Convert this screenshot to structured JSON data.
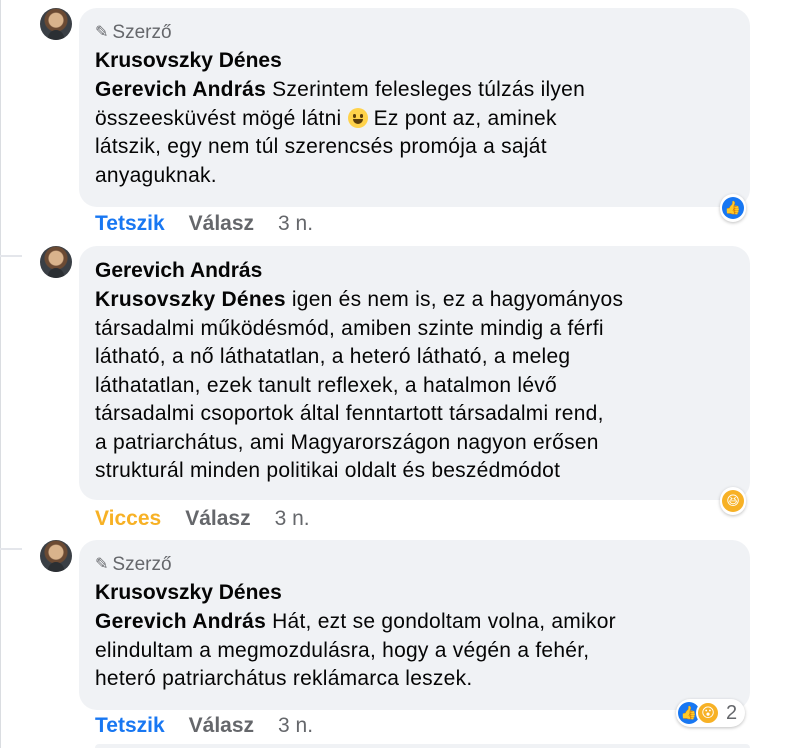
{
  "comments": [
    {
      "badge": "Szerző",
      "author": "Krusovszky Dénes",
      "mention": "Gerevich András",
      "lines": [
        " Szerintem felesleges túlzás ilyen",
        "összeesküvést mögé látni ",
        " Ez pont az, aminek",
        "látszik, egy nem túl szerencsés promója a saját",
        "anyaguknak."
      ],
      "reaction_label": "Tetszik",
      "reply_label": "Válasz",
      "time": "3 n.",
      "reactions": [
        "like"
      ]
    },
    {
      "badge": "",
      "author": "Gerevich András",
      "mention": "Krusovszky Dénes",
      "lines": [
        " igen és nem is, ez a hagyományos",
        "társadalmi működésmód, amiben szinte mindig a férfi",
        "látható, a nő láthatatlan, a heteró látható, a meleg",
        "láthatatlan, ezek tanult reflexek, a hatalmon lévő",
        "társadalmi csoportok által fenntartott társadalmi rend,",
        "a patriarchátus, ami Magyarországon nagyon erősen",
        "strukturál minden politikai oldalt és beszédmódot"
      ],
      "reaction_label": "Vicces",
      "reply_label": "Válasz",
      "time": "3 n.",
      "reactions": [
        "haha"
      ]
    },
    {
      "badge": "Szerző",
      "author": "Krusovszky Dénes",
      "mention": "Gerevich András",
      "lines": [
        " Hát, ezt se gondoltam volna, amikor",
        "elindultam a megmozdulásra, hogy a végén a fehér,",
        "heteró patriarchátus reklámarca leszek."
      ],
      "reaction_label": "Tetszik",
      "reply_label": "Válasz",
      "time": "3 n.",
      "reactions": [
        "like",
        "wow"
      ],
      "reaction_count": "2"
    }
  ],
  "colors": {
    "like": "#1877f2",
    "haha": "#f7b125",
    "bubble": "#f0f2f5",
    "meta": "#65676b"
  }
}
